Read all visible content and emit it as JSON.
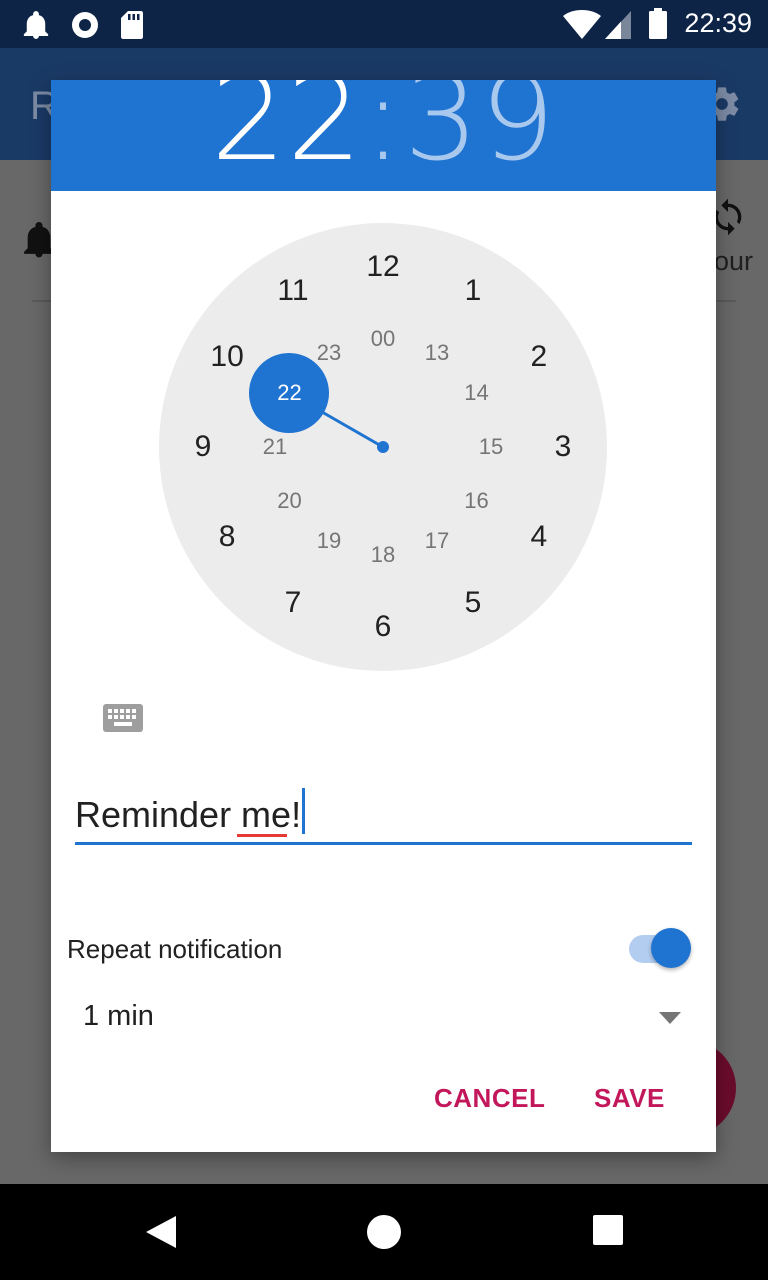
{
  "status_bar": {
    "time": "22:39",
    "left_icons": [
      "notification-bell-icon",
      "record-icon",
      "sd-card-icon"
    ],
    "right_icons": [
      "wifi-icon",
      "cell-signal-icon",
      "battery-icon"
    ]
  },
  "background_app": {
    "title_fragment": "R",
    "sync_label_fragment": "our",
    "icons": [
      "settings-gear-icon",
      "alarm-bell-icon",
      "sync-icon"
    ]
  },
  "dialog": {
    "header": {
      "hour": "22",
      "separator": ":",
      "minute": "39"
    },
    "clock": {
      "outer_numbers": [
        "12",
        "1",
        "2",
        "3",
        "4",
        "5",
        "6",
        "7",
        "8",
        "9",
        "10",
        "11"
      ],
      "inner_numbers": [
        "00",
        "13",
        "14",
        "15",
        "16",
        "17",
        "18",
        "19",
        "20",
        "21",
        "22",
        "23"
      ],
      "selected": "22"
    },
    "keyboard_icon": "keyboard-icon",
    "label_input": {
      "value": "Reminder me!"
    },
    "repeat": {
      "label": "Repeat notification",
      "enabled": true
    },
    "interval": {
      "value": "1 min"
    },
    "buttons": {
      "cancel": "CANCEL",
      "save": "SAVE"
    }
  },
  "nav_bar": {
    "icons": [
      "back-icon",
      "home-icon",
      "recents-icon"
    ]
  },
  "colors": {
    "accent": "#1f73d1",
    "button_text": "#c2185b",
    "status_bar": "#0d2447",
    "clock_face": "#ececec"
  }
}
